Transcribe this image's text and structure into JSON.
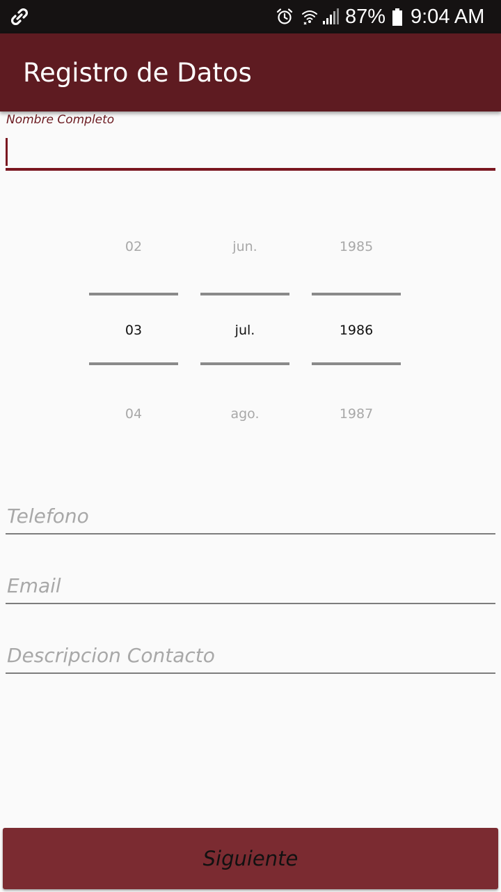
{
  "status_bar": {
    "battery_percent": "87%",
    "time": "9:04 AM",
    "icons": [
      "link-icon",
      "alarm-icon",
      "wifi-icon",
      "signal-icon",
      "battery-icon"
    ]
  },
  "app_bar": {
    "title": "Registro de Datos"
  },
  "form": {
    "name_label": "Nombre Completo",
    "name_value": "",
    "telefono_placeholder": "Telefono",
    "email_placeholder": "Email",
    "descripcion_placeholder": "Descripcion Contacto",
    "next_button": "Siguiente"
  },
  "date_picker": {
    "day": {
      "prev": "02",
      "selected": "03",
      "next": "04"
    },
    "month": {
      "prev": "jun.",
      "selected": "jul.",
      "next": "ago."
    },
    "year": {
      "prev": "1985",
      "selected": "1986",
      "next": "1987"
    }
  },
  "colors": {
    "status_bar": "#151212",
    "app_bar": "#5e1b21",
    "accent": "#7a1720",
    "button": "#7b2b31",
    "background": "#fafafa"
  }
}
